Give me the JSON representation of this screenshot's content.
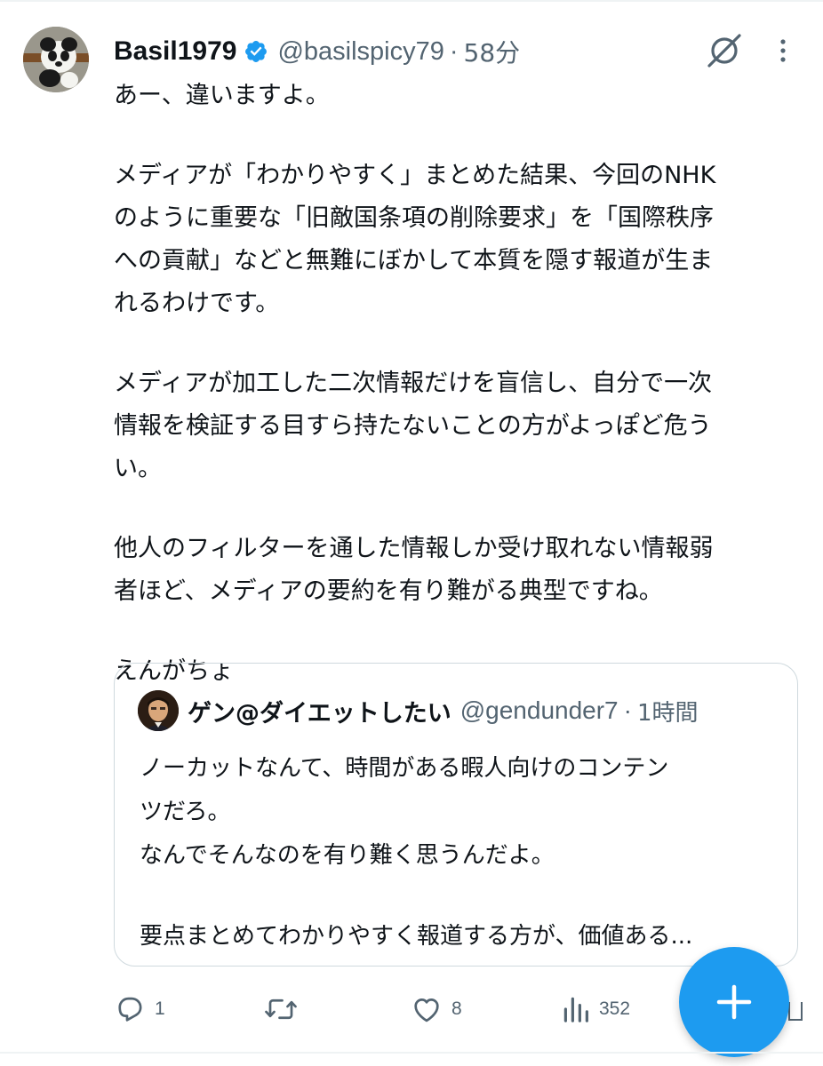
{
  "tweet": {
    "author": {
      "display_name": "Basil1979",
      "handle": "@basilspicy79",
      "verified": true,
      "avatar_icon": "panda-avatar"
    },
    "separator": "·",
    "time": "58分",
    "text": {
      "p1": [
        "あー、違いますよ。"
      ],
      "p2": [
        "メディアが「わかりやすく」まとめた結果、今回のNHK",
        "のように重要な「旧敵国条項の削除要求」を「国際秩序",
        "への貢献」などと無難にぼかして本質を隠す報道が生ま",
        "れるわけです。"
      ],
      "p3": [
        "メディアが加工した二次情報だけを盲信し、自分で一次",
        "情報を検証する目すら持たないことの方がよっぽど危う",
        "い。"
      ],
      "p4": [
        "他人のフィルターを通した情報しか受け取れない情報弱",
        "者ほど、メディアの要約を有り難がる典型ですね。"
      ],
      "p5": [
        "えんがちょ"
      ]
    }
  },
  "quote": {
    "author": {
      "display_name": "ゲン@ダイエットしたい",
      "handle": "@gendunder7",
      "avatar_icon": "portrait-avatar"
    },
    "separator": "·",
    "time": "1時間",
    "text": {
      "p1": [
        "ノーカットなんて、時間がある暇人向けのコンテン",
        "ツだろ。",
        "なんでそんなのを有り難く思うんだよ。"
      ],
      "p2": [
        "要点まとめてわかりやすく報道する方が、価値ある..."
      ]
    }
  },
  "actions": {
    "reply": {
      "icon": "reply-icon",
      "count": "1"
    },
    "repost": {
      "icon": "repost-icon",
      "count": ""
    },
    "like": {
      "icon": "heart-icon",
      "count": "8"
    },
    "views": {
      "icon": "views-icon",
      "count": "352"
    }
  },
  "fab": {
    "icon": "plus-icon"
  },
  "header_icons": {
    "grok": "grok-icon",
    "more": "more-icon"
  },
  "colors": {
    "text": "#0f1419",
    "secondary": "#536471",
    "accent": "#1d9bf0",
    "border": "#cfd9de"
  }
}
